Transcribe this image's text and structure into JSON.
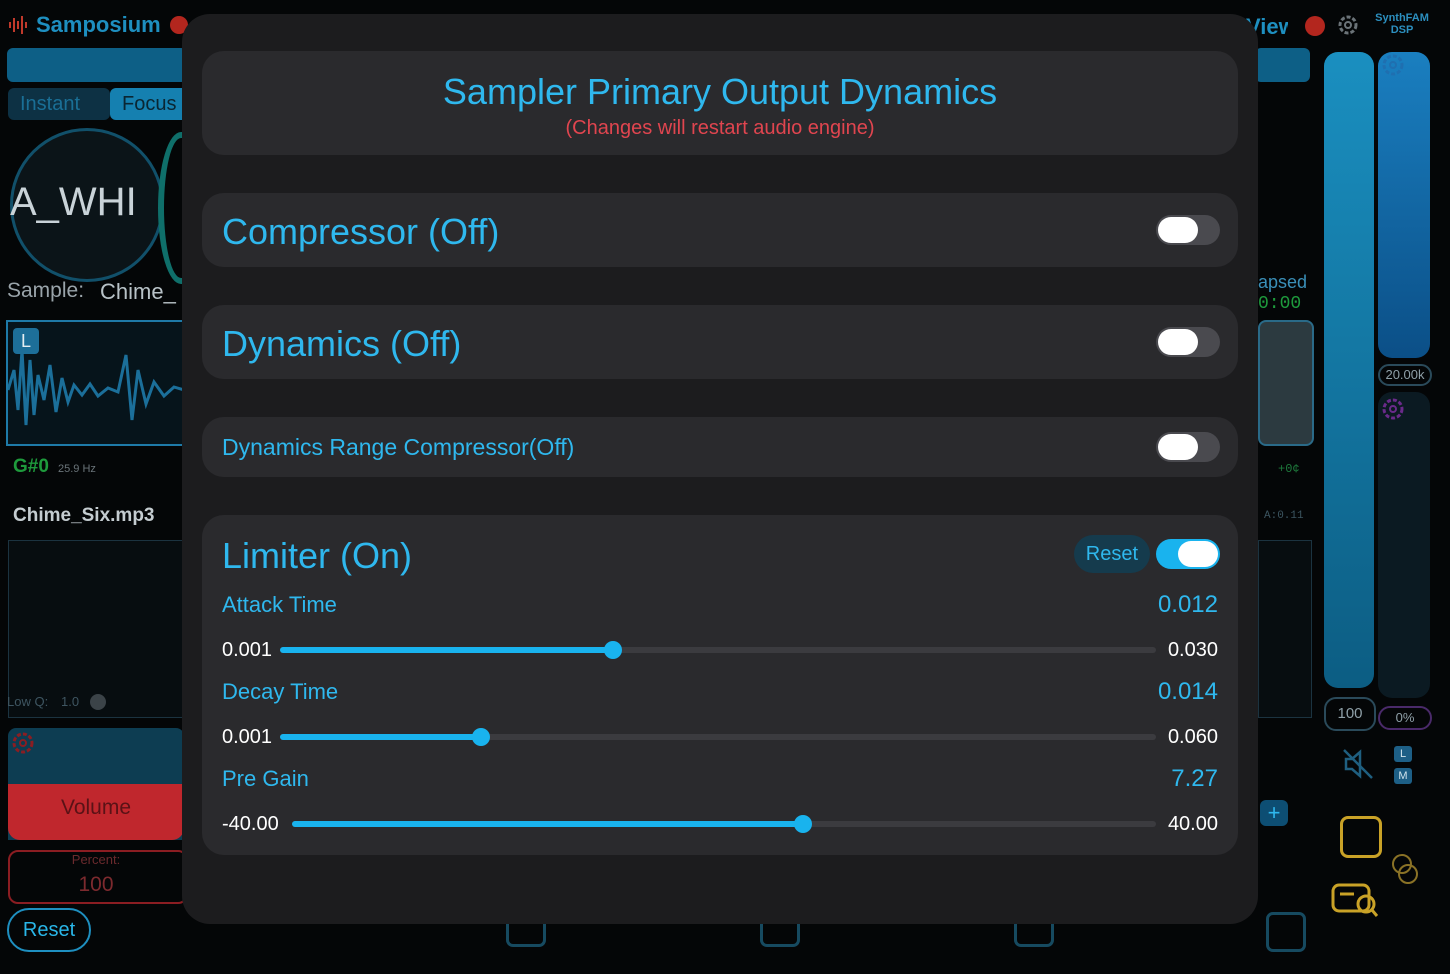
{
  "background": {
    "app_title": "Samposium",
    "top_right_title": "View",
    "brand_line1": "SynthFAM",
    "brand_line2": "DSP",
    "seg_instant": "Instant",
    "seg_focus": "Focus",
    "knob_text": "A_WHI",
    "sample_label": "Sample:",
    "sample_value": "Chime_",
    "channel_badge": "L",
    "note": "G#0",
    "note_hz": "25.9 Hz",
    "file_name": "Chime_Six.mp3",
    "low_q": "Low Q:",
    "low_q_value": "1.0",
    "volume": "Volume",
    "percent_label": "Percent:",
    "percent_value": "100",
    "reset": "Reset",
    "elapsed_label": "apsed",
    "elapsed_value": "0:00",
    "offset": "+0¢",
    "a_value": "A:0.11",
    "freq_pill": "20.00k",
    "level_pill": "100",
    "mix_pill": "0%",
    "badge_l": "L",
    "badge_m": "M",
    "plus": "+"
  },
  "modal": {
    "title": "Sampler Primary Output Dynamics",
    "subtitle": "(Changes will restart audio engine)",
    "compressor": {
      "label": "Compressor (Off)",
      "on": false
    },
    "dynamics": {
      "label": "Dynamics (Off)",
      "on": false
    },
    "drc": {
      "label": "Dynamics Range Compressor(Off)",
      "on": false
    },
    "limiter": {
      "label": "Limiter (On)",
      "on": true,
      "reset_label": "Reset",
      "params": [
        {
          "label": "Attack Time",
          "value": "0.012",
          "min": "0.001",
          "max": "0.030",
          "fraction": 0.38
        },
        {
          "label": "Decay Time",
          "value": "0.014",
          "min": "0.001",
          "max": "0.060",
          "fraction": 0.23
        },
        {
          "label": "Pre Gain",
          "value": "7.27",
          "min": "-40.00",
          "max": "40.00",
          "fraction": 0.591
        }
      ]
    }
  },
  "colors": {
    "accent": "#19b3ee",
    "warning": "#e0454f",
    "modal_bg": "#1c1c1e",
    "card_bg": "#2a2a2d"
  },
  "icons": [
    "waveform-icon",
    "record-icon",
    "gear-icon",
    "mute-speaker-icon",
    "dice-icon",
    "search-chat-icon",
    "circles-icon",
    "plus-icon"
  ]
}
